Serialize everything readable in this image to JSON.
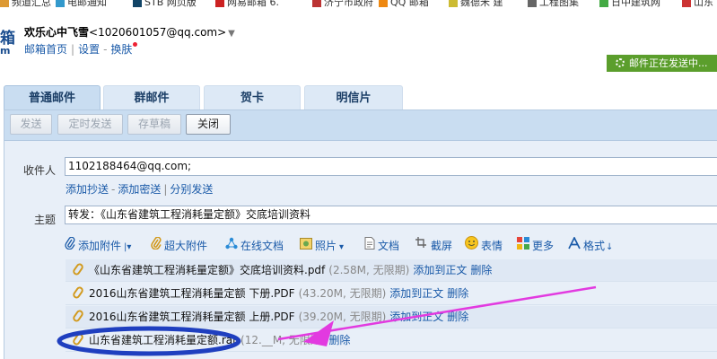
{
  "bookmarks": [
    {
      "label": "频道汇总",
      "color": "#d93"
    },
    {
      "label": "电邮通知",
      "color": "#39c"
    },
    {
      "label": "STB 网页版",
      "color": "#146"
    },
    {
      "label": "网易邮箱 6.",
      "color": "#c22"
    },
    {
      "label": "济宁市政府",
      "color": "#b33"
    },
    {
      "label": "QQ 邮箱",
      "color": "#e81"
    },
    {
      "label": "魏德米 建",
      "color": "#cb3"
    },
    {
      "label": "工程图集",
      "color": "#666"
    },
    {
      "label": "日中建筑网",
      "color": "#4a4"
    },
    {
      "label": "山东",
      "color": "#c33"
    }
  ],
  "logo": {
    "line1": "箱",
    "line2": "m"
  },
  "account": {
    "name": "欢乐心中飞雪",
    "email": "<1020601057@qq.com>",
    "menu_arrow": "▼"
  },
  "account_links": {
    "home": "邮箱首页",
    "settings": "设置",
    "skin": "换肤"
  },
  "status_bar": {
    "text": "邮件正在发送中..."
  },
  "tabs": [
    {
      "label": "普通邮件",
      "active": true
    },
    {
      "label": "群邮件",
      "active": false
    },
    {
      "label": "贺卡",
      "active": false
    },
    {
      "label": "明信片",
      "active": false
    }
  ],
  "toolbar": {
    "send": "发送",
    "timed_send": "定时发送",
    "save_draft": "存草稿",
    "close": "关闭"
  },
  "recipient": {
    "label": "收件人",
    "value": "1102188464@qq.com;"
  },
  "cc_links": {
    "add_cc": "添加抄送",
    "add_bcc": "添加密送",
    "separate_send": "分别发送"
  },
  "subject": {
    "label": "主题",
    "value": "转发：《山东省建筑工程消耗量定额》交底培训资料"
  },
  "attach_tools": {
    "add_attachment": "添加附件",
    "large_attachment": "超大附件",
    "online_docs": "在线文档",
    "photos": "照片",
    "docs": "文档",
    "screenshot": "截屏",
    "emoji": "表情",
    "more": "更多",
    "format": "格式"
  },
  "attachments": [
    {
      "name": "《山东省建筑工程消耗量定额》交底培训资料.pdf",
      "meta": "(2.58M, 无限期)",
      "add_to_body": "添加到正文",
      "delete": "删除"
    },
    {
      "name": "2016山东省建筑工程消耗量定额 下册.PDF",
      "meta": "(43.20M, 无限期)",
      "add_to_body": "添加到正文",
      "delete": "删除"
    },
    {
      "name": "2016山东省建筑工程消耗量定额 上册.PDF",
      "meta": "(39.20M, 无限期)",
      "add_to_body": "添加到正文",
      "delete": "删除"
    },
    {
      "name": "山东省建筑工程消耗量定额.rar",
      "meta": "(12.__M, 无限期)",
      "add_to_body": "",
      "delete": "删除"
    }
  ],
  "annotation": {
    "arrow_color": "#e23ae0",
    "ellipse_color": "#1f3fbf"
  }
}
